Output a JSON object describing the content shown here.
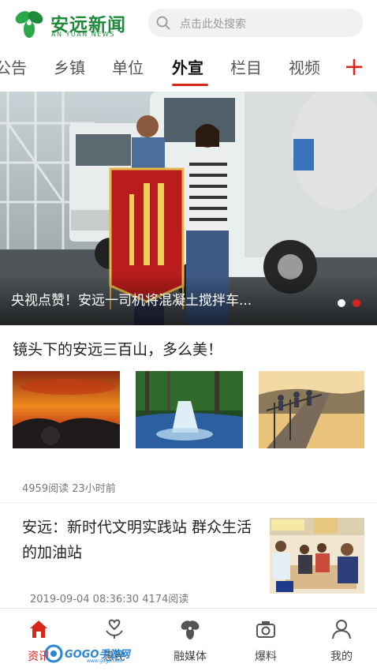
{
  "header": {
    "logo_cn": "安远新闻",
    "logo_en": "AN YUAN NEWS",
    "search_placeholder": "点击此处搜索"
  },
  "tabs": [
    {
      "label": "公告"
    },
    {
      "label": "乡镇"
    },
    {
      "label": "单位"
    },
    {
      "label": "外宣",
      "active": true
    },
    {
      "label": "栏目"
    },
    {
      "label": "视频"
    }
  ],
  "tab_add_label": "+",
  "banner": {
    "caption": "央视点赞！安远一司机将混凝土搅拌车...",
    "slide_count": 2,
    "active_slide": 2
  },
  "gallery": {
    "title": "镜头下的安远三百山，多么美！",
    "meta": "4959阅读  23小时前"
  },
  "news": {
    "title": "安远：新时代文明实践站 群众生活的加油站",
    "meta": "2019-09-04 08:36:30 4174阅读"
  },
  "bottom_nav": [
    {
      "label": "资讯",
      "icon": "home-icon",
      "active": true
    },
    {
      "label": "惠民",
      "icon": "heart-hand-icon"
    },
    {
      "label": "融媒体",
      "icon": "media-icon"
    },
    {
      "label": "爆料",
      "icon": "camera-icon"
    },
    {
      "label": "我的",
      "icon": "user-icon"
    }
  ],
  "watermark": {
    "text": "GOGO手游网",
    "sub": "www.gogo.com"
  },
  "colors": {
    "accent": "#d7261c",
    "brand_green": "#1f8a3a"
  }
}
